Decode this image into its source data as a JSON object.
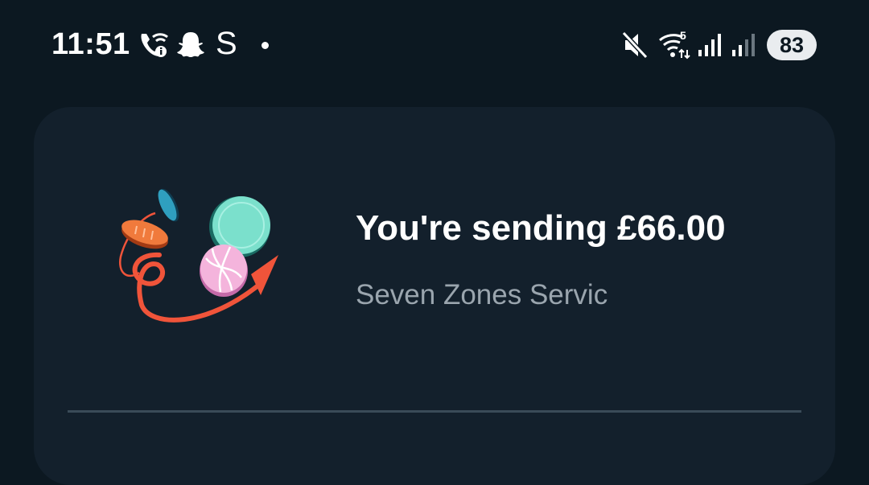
{
  "status_bar": {
    "time": "11:51",
    "left_icons": [
      "wifi-calling-icon",
      "snapchat-icon",
      "s-app-icon",
      "notification-dot-icon"
    ],
    "s_glyph": "S",
    "right_icons": [
      "mute-icon",
      "wifi-icon",
      "signal-icon",
      "signal-weak-icon"
    ],
    "wifi_badge": "5",
    "battery_level": "83"
  },
  "payment": {
    "title": "You're sending £66.00",
    "recipient": "Seven Zones Servic"
  },
  "colors": {
    "background": "#0c1821",
    "card": "#13202c",
    "divider": "#3a4b58",
    "secondary_text": "#9aa5ae",
    "accent_arrow": "#f0543a",
    "coin_teal": "#7be0cc",
    "coin_pink": "#f4b4dc",
    "coin_orange": "#f07a3c",
    "coin_blue": "#2f9fbf"
  }
}
